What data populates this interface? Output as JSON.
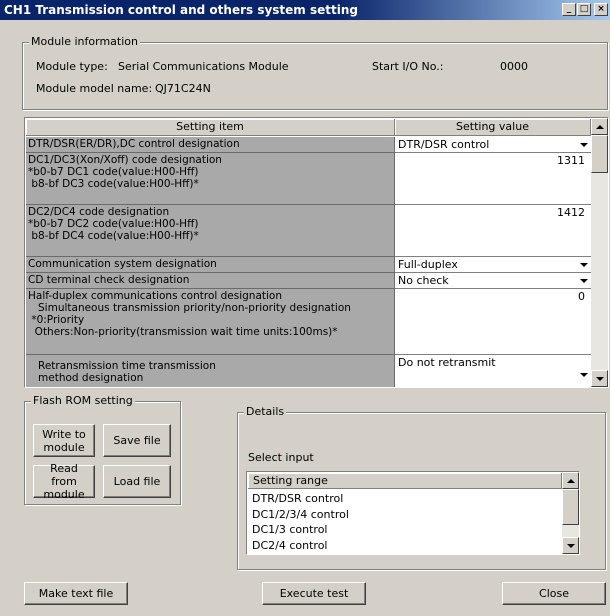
{
  "window": {
    "title": "CH1 Transmission control and others system setting",
    "controls": [
      "_",
      "□",
      "×"
    ]
  },
  "module_info": {
    "legend": "Module information",
    "type_label": "Module type:",
    "type_value": "Serial Communications Module",
    "start_io_label": "Start I/O No.:",
    "start_io_value": "0000",
    "model_label": "Module model name:",
    "model_value": "QJ71C24N"
  },
  "grid": {
    "col_item": "Setting item",
    "col_value": "Setting value",
    "rows": [
      {
        "item": "DTR/DSR(ER/DR),DC control designation",
        "value": "DTR/DSR control",
        "kind": "dropdown"
      },
      {
        "item": "DC1/DC3(Xon/Xoff) code designation\n*b0-b7 DC1 code(value:H00-Hff)\n b8-bf DC3 code(value:H00-Hff)*",
        "value": "1311",
        "kind": "number"
      },
      {
        "item": "DC2/DC4 code designation\n*b0-b7 DC2 code(value:H00-Hff)\n b8-bf DC4 code(value:H00-Hff)*",
        "value": "1412",
        "kind": "number"
      },
      {
        "item": "Communication system designation",
        "value": "Full-duplex",
        "kind": "dropdown"
      },
      {
        "item": "CD terminal check designation",
        "value": "No check",
        "kind": "dropdown"
      },
      {
        "item": "Half-duplex communications control designation\n   Simultaneous transmission priority/non-priority designation\n *0:Priority\n  Others:Non-priority(transmission wait time units:100ms)*",
        "value": "0",
        "kind": "number"
      },
      {
        "item": "   Retransmission time transmission\n   method designation",
        "value": "Do not retransmit",
        "kind": "dropdown"
      }
    ]
  },
  "flash_rom": {
    "legend": "Flash ROM setting",
    "write_label": "Write to module",
    "save_label": "Save file",
    "read_label": "Read from module",
    "load_label": "Load file"
  },
  "details": {
    "legend": "Details",
    "select_input": "Select input",
    "list_header": "Setting range",
    "options": [
      "DTR/DSR control",
      "DC1/2/3/4 control",
      "DC1/3 control",
      "DC2/4 control"
    ]
  },
  "footer": {
    "make_text_label": "Make text file",
    "execute_label": "Execute test",
    "close_label": "Close"
  }
}
